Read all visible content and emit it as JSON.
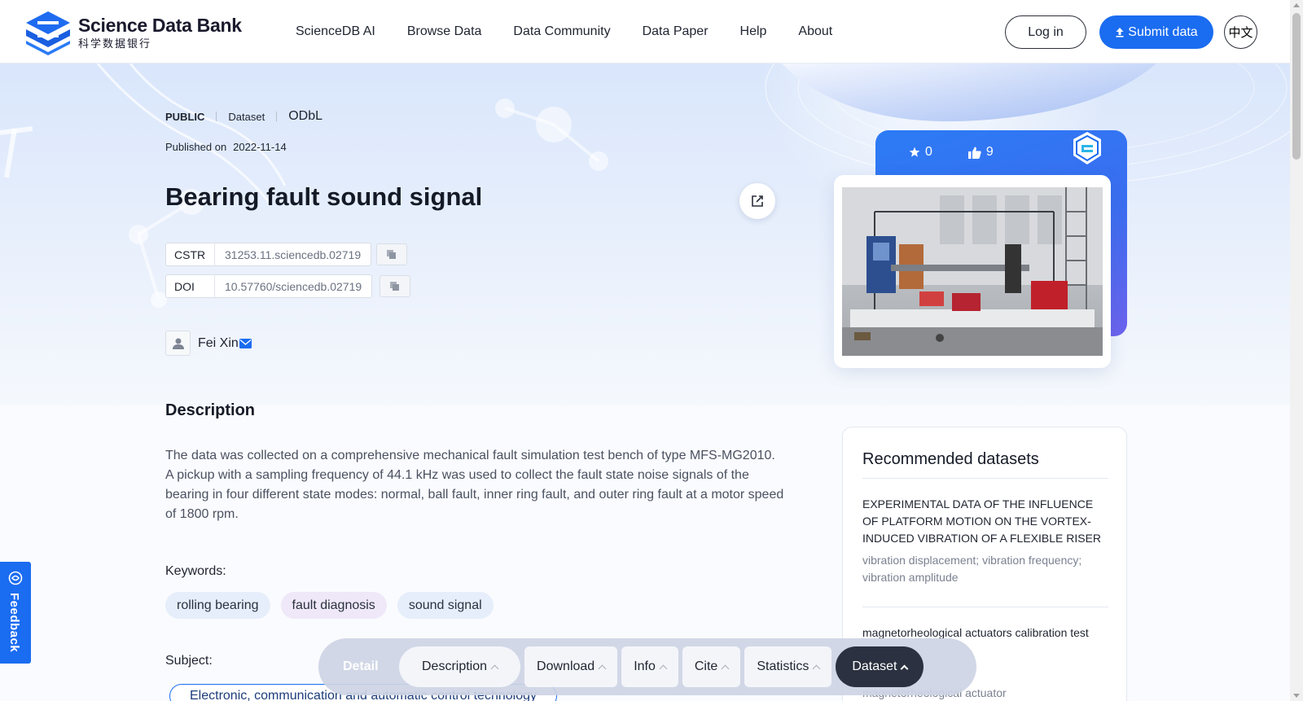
{
  "header": {
    "logo_en": "Science Data Bank",
    "logo_cn": "科学数据银行",
    "nav": [
      "ScienceDB AI",
      "Browse Data",
      "Data Community",
      "Data Paper",
      "Help",
      "About"
    ],
    "login_label": "Log in",
    "submit_label": "Submit data",
    "lang_label": "中文"
  },
  "dataset": {
    "access": "PUBLIC",
    "type": "Dataset",
    "license": "ODbL",
    "published_label": "Published on",
    "published_date": "2022-11-14",
    "title": "Bearing fault sound signal",
    "cstr_label": "CSTR",
    "cstr_value": "31253.11.sciencedb.02719",
    "doi_label": "DOI",
    "doi_value": "10.57760/sciencedb.02719",
    "author": "Fei Xin",
    "stars": "0",
    "likes": "9"
  },
  "description": {
    "heading": "Description",
    "text": "The data was collected on a comprehensive mechanical fault simulation test bench of type MFS-MG2010. A pickup with a sampling frequency of 44.1 kHz was used to collect the fault state noise signals of the bearing in four different state modes: normal, ball fault, inner ring fault, and outer ring fault at a motor speed of 1800 rpm."
  },
  "keywords": {
    "label": "Keywords:",
    "items": [
      "rolling bearing",
      "fault diagnosis",
      "sound signal"
    ]
  },
  "subject": {
    "label": "Subject:",
    "value": "Electronic, communication and automatic control technology"
  },
  "recommended": {
    "title": "Recommended datasets",
    "items": [
      {
        "title": "EXPERIMENTAL DATA OF THE INFLUENCE OF PLATFORM MOTION ON THE VORTEX-INDUCED VIBRATION OF A FLEXIBLE RISER",
        "keywords": "vibration displacement; vibration frequency; vibration amplitude"
      },
      {
        "title": "magnetorheological actuators calibration test",
        "keywords": "magnetorheological actuator"
      }
    ]
  },
  "tabbar": {
    "detail": "Detail",
    "tabs": [
      "Description",
      "Download",
      "Info",
      "Cite",
      "Statistics"
    ],
    "active": "Dataset"
  },
  "feedback": "Feedback",
  "colors": {
    "accent": "#1a6cf0",
    "dark_tab": "#2b3140"
  }
}
